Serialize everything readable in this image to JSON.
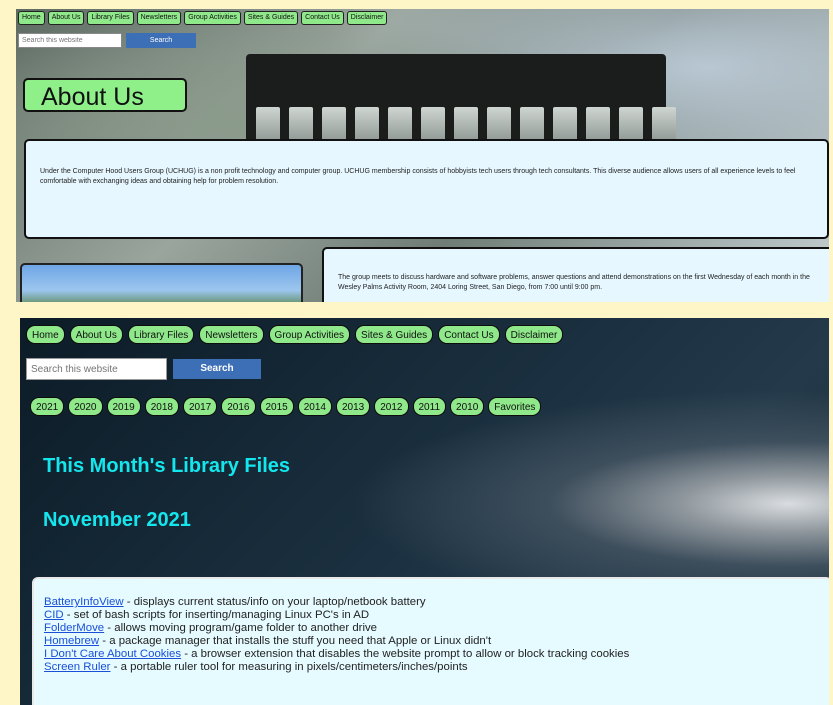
{
  "top": {
    "nav": [
      "Home",
      "About Us",
      "Library Files",
      "Newsletters",
      "Group Activities",
      "Sites & Guides",
      "Contact Us",
      "Disclaimer"
    ],
    "search_placeholder": "Search this website",
    "search_button": "Search",
    "title": "About Us",
    "intro": "Under the Computer Hood Users Group (UCHUG) is a non profit technology and computer group. UCHUG membership consists of hobbyists tech users through tech consultants. This diverse audience allows users of all experience levels to feel comfortable with exchanging ideas and obtaining help for problem resolution.",
    "meeting": "The group meets to discuss hardware and software problems, answer questions and attend demonstrations on the first Wednesday of each month in the Wesley Palms Activity Room, 2404 Loring Street, San Diego, from 7:00 until 9:00 pm."
  },
  "bottom": {
    "nav": [
      "Home",
      "About Us",
      "Library Files",
      "Newsletters",
      "Group Activities",
      "Sites & Guides",
      "Contact Us",
      "Disclaimer"
    ],
    "search_placeholder": "Search this website",
    "search_button": "Search",
    "years": [
      "2021",
      "2020",
      "2019",
      "2018",
      "2017",
      "2016",
      "2015",
      "2014",
      "2013",
      "2012",
      "2011",
      "2010",
      "Favorites"
    ],
    "heading": "This Month's Library Files",
    "month": "November 2021",
    "files": [
      {
        "name": "BatteryInfoView",
        "desc": " - displays current status/info on your laptop/netbook battery"
      },
      {
        "name": "CID",
        "desc": " - set of bash scripts for inserting/managing Linux PC's in AD"
      },
      {
        "name": "FolderMove",
        "desc": " - allows moving program/game folder to another drive"
      },
      {
        "name": "Homebrew",
        "desc": " - a package manager that installs the stuff you need that Apple or Linux didn't"
      },
      {
        "name": "I Don't Care About Cookies",
        "desc": " - a browser extension that disables the website prompt to allow or block tracking cookies"
      },
      {
        "name": "Screen Ruler",
        "desc": " - a portable ruler tool for measuring in pixels/centimeters/inches/points"
      }
    ]
  }
}
